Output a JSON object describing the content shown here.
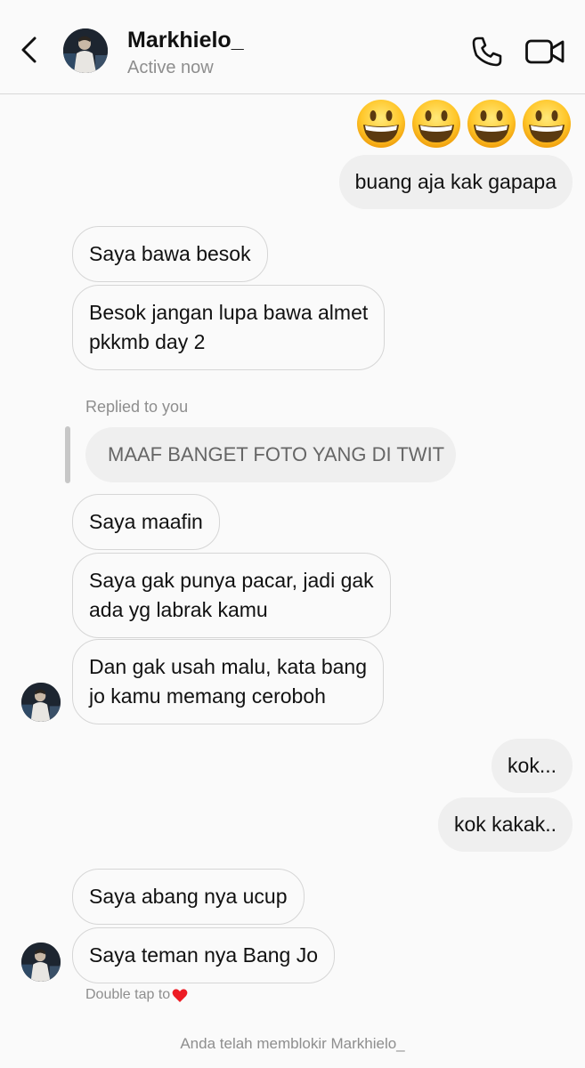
{
  "header": {
    "contact_name": "Markhielo_",
    "status": "Active now",
    "icons": [
      "back-arrow-icon",
      "phone-icon",
      "video-camera-icon"
    ]
  },
  "emojis": [
    "grinning-face-emoji",
    "grinning-face-emoji",
    "grinning-face-emoji",
    "grinning-face-emoji"
  ],
  "messages": [
    {
      "from": "me",
      "text": "buang aja kak gapapa"
    },
    {
      "from": "them",
      "text": "Saya bawa besok"
    },
    {
      "from": "them",
      "lines": [
        "Besok jangan lupa bawa almet",
        "pkkmb day 2"
      ]
    },
    {
      "from": "them",
      "text": "Saya maafin"
    },
    {
      "from": "them",
      "lines": [
        "Saya gak punya pacar, jadi gak",
        "ada yg labrak kamu"
      ]
    },
    {
      "from": "them",
      "lines": [
        "Dan gak usah malu, kata bang",
        "jo kamu memang ceroboh"
      ]
    },
    {
      "from": "me",
      "text": "kok..."
    },
    {
      "from": "me",
      "text": "kok kakak.."
    },
    {
      "from": "them",
      "text": "Saya abang nya ucup"
    },
    {
      "from": "them",
      "text": "Saya teman nya Bang Jo"
    }
  ],
  "reply": {
    "label": "Replied to you",
    "quoted_text": "MAAF BANGET FOTO YANG DI TWIT"
  },
  "footer": {
    "double_tap": "Double tap to",
    "heart_icon": "red-heart-icon",
    "blocked_notice": "Anda telah memblokir Markhielo_"
  },
  "colors": {
    "background": "#fafafa",
    "my_bubble": "#efefef",
    "their_bubble_border": "#d6d6d6",
    "secondary_text": "#8e8e8e",
    "heart": "#ed1c24"
  }
}
